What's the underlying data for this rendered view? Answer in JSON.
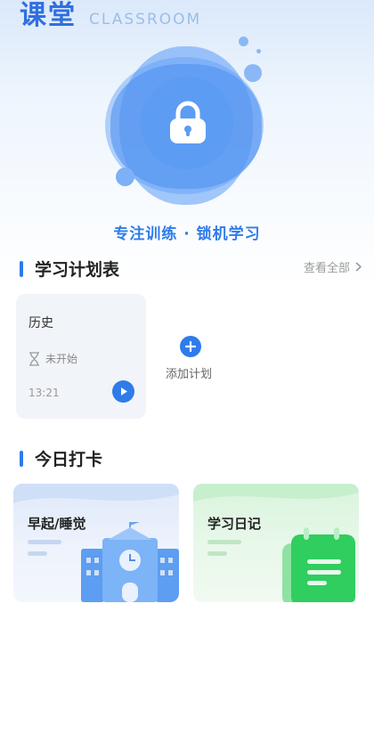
{
  "brand": {
    "title_cn": "课堂",
    "title_en": "CLASSROOM"
  },
  "hero": {
    "slogan": "专注训练 · 锁机学习",
    "icon": "lock-icon"
  },
  "plan_section": {
    "title": "学习计划表",
    "view_all": "查看全部",
    "plans": [
      {
        "name": "历史",
        "status": "未开始",
        "time": "13:21"
      }
    ],
    "add_label": "添加计划"
  },
  "checkin_section": {
    "title": "今日打卡",
    "cards": [
      {
        "title": "早起/睡觉",
        "icon": "school-building-icon"
      },
      {
        "title": "学习日记",
        "icon": "notebook-icon"
      }
    ]
  },
  "colors": {
    "accent": "#2f7bea",
    "card_blue": "#dfe9fa",
    "card_green": "#d9f4dd",
    "text_dark": "#222222",
    "text_muted": "#9a9a9a"
  }
}
